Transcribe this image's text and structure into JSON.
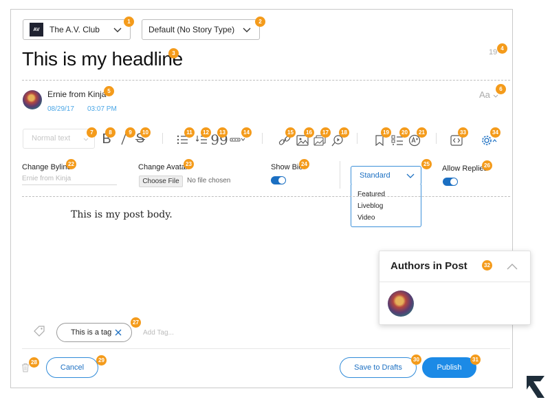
{
  "site_select": {
    "logo_text": "AV",
    "value": "The A.V. Club",
    "icon": "chevron-down-icon"
  },
  "story_type_select": {
    "value": "Default (No Story Type)",
    "icon": "chevron-down-icon"
  },
  "headline": "This is my headline",
  "char_count": "19",
  "author": {
    "name": "Ernie from Kinja",
    "date": "08/29/17",
    "time": "03:07 PM"
  },
  "font_menu": {
    "label": "Aa"
  },
  "toolbar": {
    "text_style": "Normal text",
    "tools": [
      "bold-icon",
      "italic-icon",
      "strikethrough-icon",
      "bulleted-list-icon",
      "numbered-list-icon",
      "quote-icon",
      "more-icon",
      "link-icon",
      "image-icon",
      "image-gallery-icon",
      "embed-icon",
      "bookmark-icon",
      "checklist-icon",
      "text-size-icon",
      "code-icon",
      "settings-icon"
    ]
  },
  "settings": {
    "change_byline_label": "Change Byline",
    "byline_placeholder": "Ernie from Kinja",
    "change_avatar_label": "Change Avatar",
    "choose_file": "Choose File",
    "no_file": "No file chosen",
    "show_bio_label": "Show Bio",
    "show_bio": true,
    "allow_replies_label": "Allow Replies",
    "allow_replies": true,
    "post_type": {
      "selected": "Standard",
      "options": [
        "Featured",
        "Liveblog",
        "Video"
      ]
    }
  },
  "post_body": "This is my post body.",
  "authors_panel": {
    "title": "Authors in Post"
  },
  "tags": {
    "items": [
      "This is a tag"
    ],
    "placeholder": "Add Tag..."
  },
  "actions": {
    "cancel": "Cancel",
    "save_drafts": "Save to Drafts",
    "publish": "Publish"
  },
  "annotations": [
    "1",
    "2",
    "3",
    "4",
    "5",
    "6",
    "7",
    "8",
    "9",
    "10",
    "11",
    "12",
    "13",
    "14",
    "15",
    "16",
    "17",
    "18",
    "19",
    "20",
    "21",
    "22",
    "23",
    "24",
    "25",
    "26",
    "27",
    "28",
    "29",
    "30",
    "31",
    "32",
    "33",
    "34"
  ],
  "colors": {
    "accent": "#1c8ae6",
    "badge": "#f49b1b",
    "link": "#4aa6e6"
  }
}
